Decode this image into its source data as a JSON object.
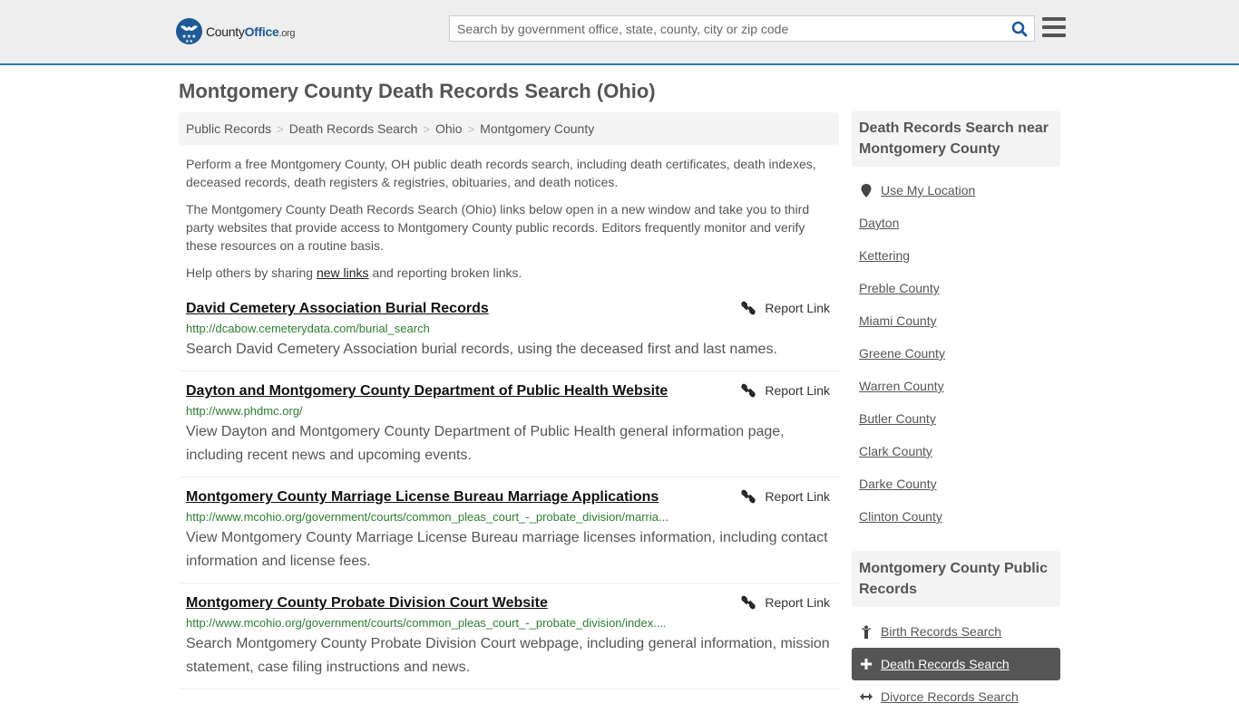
{
  "header": {
    "logo": {
      "prefix": "County",
      "brand": "Office",
      "suffix": ".org"
    },
    "search_placeholder": "Search by government office, state, county, city or zip code",
    "search_value": "",
    "search_icon": "search-icon",
    "menu_icon": "hamburger-icon",
    "accent_color": "#2a76b5"
  },
  "page_title": "Montgomery County Death Records Search (Ohio)",
  "breadcrumb": [
    "Public Records",
    "Death Records Search",
    "Ohio",
    "Montgomery County"
  ],
  "intro": {
    "p1": "Perform a free Montgomery County, OH public death records search, including death certificates, death indexes, deceased records, death registers & registries, obituaries, and death notices.",
    "p2": "The Montgomery County Death Records Search (Ohio) links below open in a new window and take you to third party websites that provide access to Montgomery County public records. Editors frequently monitor and verify these resources on a routine basis.",
    "p3_before": "Help others by sharing ",
    "p3_link": "new links",
    "p3_after": " and reporting broken links."
  },
  "report_label": "Report Link",
  "listings": [
    {
      "title": "David Cemetery Association Burial Records",
      "url": "http://dcabow.cemeterydata.com/burial_search",
      "description": "Search David Cemetery Association burial records, using the deceased first and last names."
    },
    {
      "title": "Dayton and Montgomery County Department of Public Health Website",
      "url": "http://www.phdmc.org/",
      "description": "View Dayton and Montgomery County Department of Public Health general information page, including recent news and upcoming events."
    },
    {
      "title": "Montgomery County Marriage License Bureau Marriage Applications",
      "url": "http://www.mcohio.org/government/courts/common_pleas_court_-_probate_division/marria...",
      "description": "View Montgomery County Marriage License Bureau marriage licenses information, including contact information and license fees."
    },
    {
      "title": "Montgomery County Probate Division Court Website",
      "url": "http://www.mcohio.org/government/courts/common_pleas_court_-_probate_division/index....",
      "description": "Search Montgomery County Probate Division Court webpage, including general information, mission statement, case filing instructions and news."
    }
  ],
  "sidebar": {
    "nearby_title": "Death Records Search near Montgomery County",
    "use_location": "Use My Location",
    "nearby": [
      "Dayton",
      "Kettering",
      "Preble County",
      "Miami County",
      "Greene County",
      "Warren County",
      "Butler County",
      "Clark County",
      "Darke County",
      "Clinton County"
    ],
    "records_title": "Montgomery County Public Records",
    "records": [
      {
        "label": "Birth Records Search",
        "icon": "child-icon",
        "active": false
      },
      {
        "label": "Death Records Search",
        "icon": "plus-icon",
        "active": true
      },
      {
        "label": "Divorce Records Search",
        "icon": "arrows-horizontal-icon",
        "active": false
      }
    ]
  }
}
